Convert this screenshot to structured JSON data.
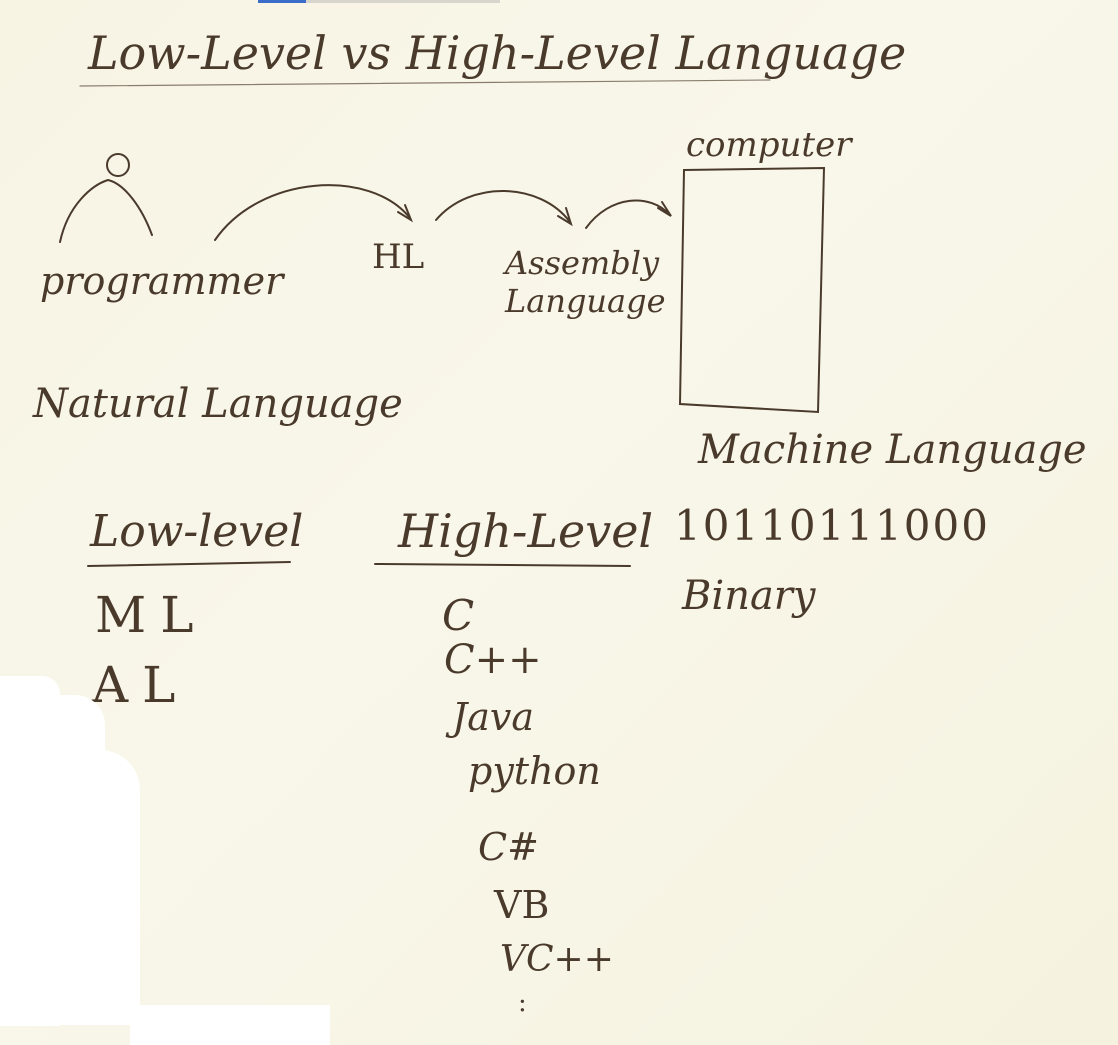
{
  "title": "Low-Level vs High-Level Language",
  "diagram": {
    "programmer_label": "programmer",
    "hl_label": "HL",
    "assembly_label": "Assembly Language",
    "computer_label": "computer",
    "natural_language_label": "Natural Language",
    "machine_language_label": "Machine Language",
    "binary_example": "10110111000",
    "binary_label": "Binary"
  },
  "columns": {
    "low_level": {
      "heading": "Low-level",
      "items": [
        "ML",
        "AL"
      ]
    },
    "high_level": {
      "heading": "High-Level",
      "items": [
        "C",
        "C++",
        "Java",
        "python",
        "C#",
        "VB",
        "VC++",
        ":"
      ]
    }
  }
}
